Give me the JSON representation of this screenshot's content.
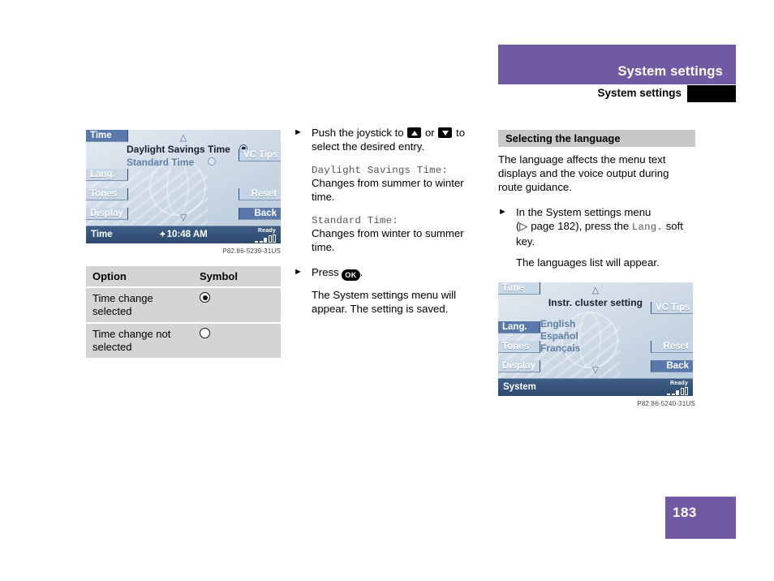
{
  "header": {
    "band_title": "System settings",
    "running_title": "System settings"
  },
  "footer": {
    "page_number": "183"
  },
  "left_column": {
    "screen": {
      "soft_keys_left": [
        {
          "label": "Time",
          "state": "active"
        },
        {
          "label": "Lang.",
          "state": "dim"
        },
        {
          "label": "Tones",
          "state": "dim"
        },
        {
          "label": "Display",
          "state": "dim"
        }
      ],
      "soft_keys_right": [
        {
          "label": "VC Tips",
          "state": "dim"
        },
        {
          "label": "Reset",
          "state": "dim"
        },
        {
          "label": "Back",
          "state": "active"
        }
      ],
      "option_rows": [
        {
          "label": "Daylight Savings Time",
          "selected": true
        },
        {
          "label": "Standard Time",
          "selected": false
        }
      ],
      "scroll_up": "△",
      "scroll_down": "▽",
      "status": {
        "label": "Time",
        "clock": "10:48 AM",
        "sat_icon": "毛",
        "ready": "Ready"
      }
    },
    "image_code": "P82.86-5239-31US",
    "table": {
      "headers": [
        "Option",
        "Symbol"
      ],
      "rows": [
        {
          "option": "Time change selected",
          "symbol": "filled-radio"
        },
        {
          "option": "Time change not selected",
          "symbol": "empty-radio"
        }
      ]
    }
  },
  "middle_column": {
    "step1": {
      "text_before": "Push the joystick to",
      "text_or": "or",
      "text_after": "to select the desired entry."
    },
    "def1": {
      "term": "Daylight Savings Time:",
      "desc": "Changes from summer to winter time."
    },
    "def2": {
      "term": "Standard Time:",
      "desc": "Changes from winter to summer time."
    },
    "step2": {
      "text_before": "Press",
      "key": "OK",
      "text_after": "."
    },
    "result": "The System settings menu will appear. The setting is saved."
  },
  "right_column": {
    "section_heading": "Selecting the language",
    "intro": "The language affects the menu text displays and the voice output during route guidance.",
    "step": {
      "line1": "In the System settings menu",
      "line2_before": "(▷ page 182), press the",
      "line2_key": "Lang.",
      "line2_after": "soft key."
    },
    "result": "The languages list will appear.",
    "screen": {
      "soft_keys_left": [
        {
          "label": "Time",
          "state": "dim"
        },
        {
          "label": "Lang.",
          "state": "active"
        },
        {
          "label": "Tones",
          "state": "dim"
        },
        {
          "label": "Display",
          "state": "dim"
        }
      ],
      "soft_keys_right": [
        {
          "label": "VC Tips",
          "state": "dim"
        },
        {
          "label": "Reset",
          "state": "dim"
        },
        {
          "label": "Back",
          "state": "active"
        }
      ],
      "title": "Instr. cluster setting",
      "languages": [
        "English",
        "Español",
        "Français"
      ],
      "scroll_up": "△",
      "scroll_down": "▽",
      "status": {
        "label": "System",
        "ready": "Ready"
      }
    },
    "image_code": "P82.86-5240-31US"
  },
  "colors": {
    "brand_purple": "#6f5aa3",
    "heading_gray": "#c8c8c8",
    "table_gray": "#d4d4d4",
    "screen_active_key": "#5a78ac"
  }
}
